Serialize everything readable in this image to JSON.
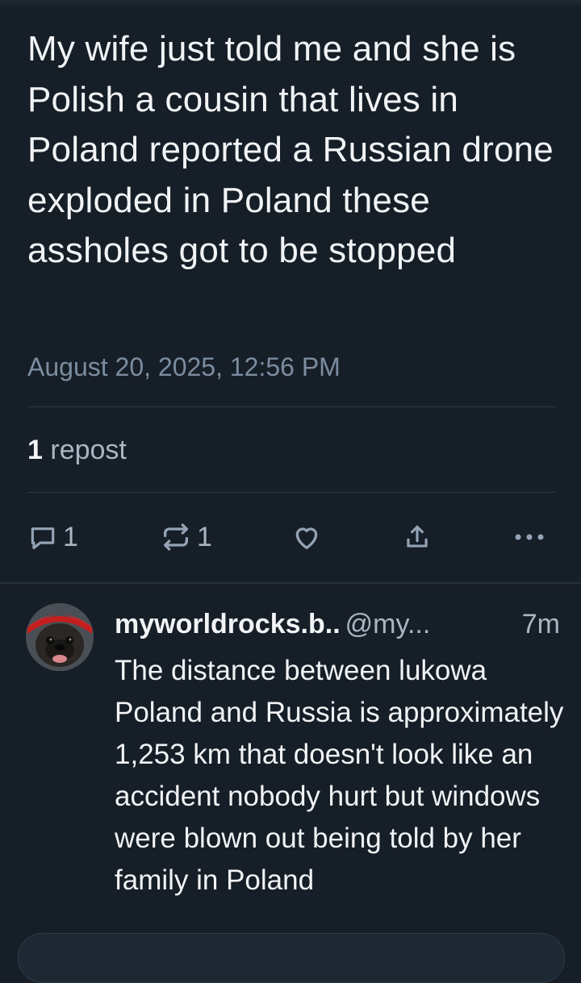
{
  "post": {
    "text": "My wife just told me and she is Polish a cousin that lives in Poland reported a Russian drone exploded in Poland these assholes got to be stopped",
    "timestamp": "August 20, 2025, 12:56 PM",
    "repost_count": "1",
    "repost_label": "repost",
    "actions": {
      "reply_count": "1",
      "repost_count": "1",
      "reply_icon": "comment-icon",
      "repost_icon": "repost-icon",
      "like_icon": "heart-icon",
      "share_icon": "share-icon",
      "more_icon": "more-dots-icon"
    }
  },
  "reply": {
    "display_name": "myworldrocks.b..",
    "handle": "@my...",
    "time": "7m",
    "text": "The distance between lukowa Poland and Russia is approximately 1,253 km that doesn't look like an accident nobody hurt but windows were blown out being told by her family in Poland"
  },
  "colors": {
    "background": "#161e27",
    "text_primary": "#f1f3f5",
    "text_secondary": "#7b8da0",
    "divider": "#2c3a4a"
  }
}
